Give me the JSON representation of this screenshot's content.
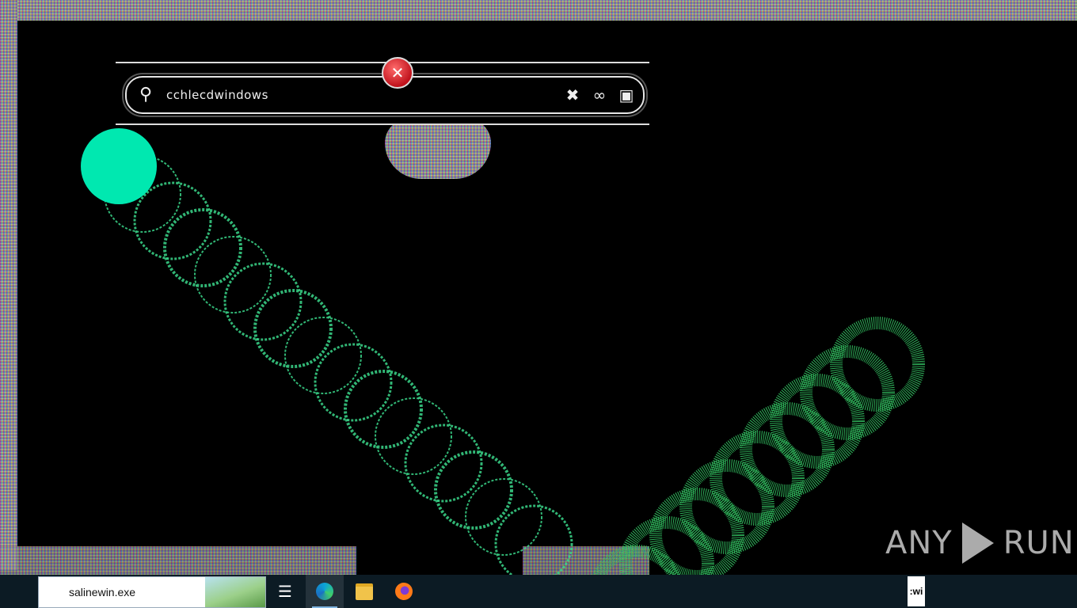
{
  "search_dialog": {
    "query": "cchlecdwindows",
    "search_icon": "search-icon",
    "clear_icon": "close-icon",
    "voice_icon": "loop-icon",
    "options_icon": "app-icon"
  },
  "error_icon": "error-x-icon",
  "watermark": {
    "left_text": "ANY",
    "right_text": "RUN"
  },
  "trail_colors": {
    "solid": "#00e8b0",
    "left_trail": "#39d68a",
    "right_trail": "#32c060"
  },
  "taskbar": {
    "search_text": "salinewin.exe",
    "task_view_icon": "task-view-icon",
    "edge_icon": "edge-icon",
    "explorer_icon": "folder-icon",
    "firefox_icon": "firefox-icon",
    "clipped_text": ":wi"
  }
}
